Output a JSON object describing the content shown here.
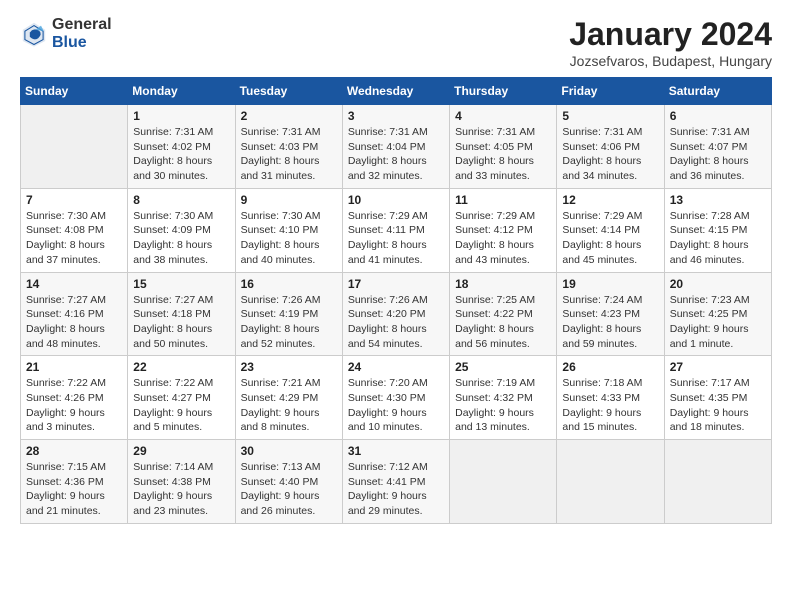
{
  "header": {
    "logo_general": "General",
    "logo_blue": "Blue",
    "title": "January 2024",
    "subtitle": "Jozsefvaros, Budapest, Hungary"
  },
  "calendar": {
    "days_of_week": [
      "Sunday",
      "Monday",
      "Tuesday",
      "Wednesday",
      "Thursday",
      "Friday",
      "Saturday"
    ],
    "weeks": [
      [
        {
          "day": "",
          "info": ""
        },
        {
          "day": "1",
          "info": "Sunrise: 7:31 AM\nSunset: 4:02 PM\nDaylight: 8 hours\nand 30 minutes."
        },
        {
          "day": "2",
          "info": "Sunrise: 7:31 AM\nSunset: 4:03 PM\nDaylight: 8 hours\nand 31 minutes."
        },
        {
          "day": "3",
          "info": "Sunrise: 7:31 AM\nSunset: 4:04 PM\nDaylight: 8 hours\nand 32 minutes."
        },
        {
          "day": "4",
          "info": "Sunrise: 7:31 AM\nSunset: 4:05 PM\nDaylight: 8 hours\nand 33 minutes."
        },
        {
          "day": "5",
          "info": "Sunrise: 7:31 AM\nSunset: 4:06 PM\nDaylight: 8 hours\nand 34 minutes."
        },
        {
          "day": "6",
          "info": "Sunrise: 7:31 AM\nSunset: 4:07 PM\nDaylight: 8 hours\nand 36 minutes."
        }
      ],
      [
        {
          "day": "7",
          "info": "Sunrise: 7:30 AM\nSunset: 4:08 PM\nDaylight: 8 hours\nand 37 minutes."
        },
        {
          "day": "8",
          "info": "Sunrise: 7:30 AM\nSunset: 4:09 PM\nDaylight: 8 hours\nand 38 minutes."
        },
        {
          "day": "9",
          "info": "Sunrise: 7:30 AM\nSunset: 4:10 PM\nDaylight: 8 hours\nand 40 minutes."
        },
        {
          "day": "10",
          "info": "Sunrise: 7:29 AM\nSunset: 4:11 PM\nDaylight: 8 hours\nand 41 minutes."
        },
        {
          "day": "11",
          "info": "Sunrise: 7:29 AM\nSunset: 4:12 PM\nDaylight: 8 hours\nand 43 minutes."
        },
        {
          "day": "12",
          "info": "Sunrise: 7:29 AM\nSunset: 4:14 PM\nDaylight: 8 hours\nand 45 minutes."
        },
        {
          "day": "13",
          "info": "Sunrise: 7:28 AM\nSunset: 4:15 PM\nDaylight: 8 hours\nand 46 minutes."
        }
      ],
      [
        {
          "day": "14",
          "info": "Sunrise: 7:27 AM\nSunset: 4:16 PM\nDaylight: 8 hours\nand 48 minutes."
        },
        {
          "day": "15",
          "info": "Sunrise: 7:27 AM\nSunset: 4:18 PM\nDaylight: 8 hours\nand 50 minutes."
        },
        {
          "day": "16",
          "info": "Sunrise: 7:26 AM\nSunset: 4:19 PM\nDaylight: 8 hours\nand 52 minutes."
        },
        {
          "day": "17",
          "info": "Sunrise: 7:26 AM\nSunset: 4:20 PM\nDaylight: 8 hours\nand 54 minutes."
        },
        {
          "day": "18",
          "info": "Sunrise: 7:25 AM\nSunset: 4:22 PM\nDaylight: 8 hours\nand 56 minutes."
        },
        {
          "day": "19",
          "info": "Sunrise: 7:24 AM\nSunset: 4:23 PM\nDaylight: 8 hours\nand 59 minutes."
        },
        {
          "day": "20",
          "info": "Sunrise: 7:23 AM\nSunset: 4:25 PM\nDaylight: 9 hours\nand 1 minute."
        }
      ],
      [
        {
          "day": "21",
          "info": "Sunrise: 7:22 AM\nSunset: 4:26 PM\nDaylight: 9 hours\nand 3 minutes."
        },
        {
          "day": "22",
          "info": "Sunrise: 7:22 AM\nSunset: 4:27 PM\nDaylight: 9 hours\nand 5 minutes."
        },
        {
          "day": "23",
          "info": "Sunrise: 7:21 AM\nSunset: 4:29 PM\nDaylight: 9 hours\nand 8 minutes."
        },
        {
          "day": "24",
          "info": "Sunrise: 7:20 AM\nSunset: 4:30 PM\nDaylight: 9 hours\nand 10 minutes."
        },
        {
          "day": "25",
          "info": "Sunrise: 7:19 AM\nSunset: 4:32 PM\nDaylight: 9 hours\nand 13 minutes."
        },
        {
          "day": "26",
          "info": "Sunrise: 7:18 AM\nSunset: 4:33 PM\nDaylight: 9 hours\nand 15 minutes."
        },
        {
          "day": "27",
          "info": "Sunrise: 7:17 AM\nSunset: 4:35 PM\nDaylight: 9 hours\nand 18 minutes."
        }
      ],
      [
        {
          "day": "28",
          "info": "Sunrise: 7:15 AM\nSunset: 4:36 PM\nDaylight: 9 hours\nand 21 minutes."
        },
        {
          "day": "29",
          "info": "Sunrise: 7:14 AM\nSunset: 4:38 PM\nDaylight: 9 hours\nand 23 minutes."
        },
        {
          "day": "30",
          "info": "Sunrise: 7:13 AM\nSunset: 4:40 PM\nDaylight: 9 hours\nand 26 minutes."
        },
        {
          "day": "31",
          "info": "Sunrise: 7:12 AM\nSunset: 4:41 PM\nDaylight: 9 hours\nand 29 minutes."
        },
        {
          "day": "",
          "info": ""
        },
        {
          "day": "",
          "info": ""
        },
        {
          "day": "",
          "info": ""
        }
      ]
    ]
  }
}
